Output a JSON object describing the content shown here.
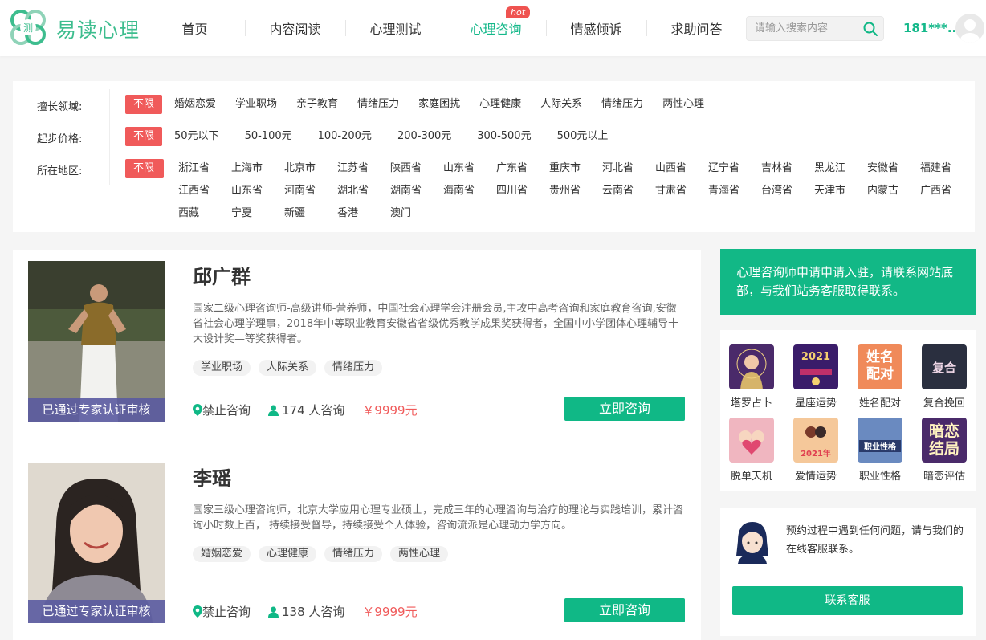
{
  "header": {
    "logo_text": "易读心理",
    "nav": [
      {
        "label": "首页"
      },
      {
        "label": "内容阅读"
      },
      {
        "label": "心理测试"
      },
      {
        "label": "心理咨询",
        "badge": "hot"
      },
      {
        "label": "情感倾诉"
      },
      {
        "label": "求助问答"
      }
    ],
    "search_placeholder": "请输入搜索内容",
    "user_name": "181***..."
  },
  "filters": {
    "field": {
      "label": "擅长领域:",
      "options": [
        "不限",
        "婚姻恋爱",
        "学业职场",
        "亲子教育",
        "情绪压力",
        "家庭困扰",
        "心理健康",
        "人际关系",
        "情绪压力",
        "两性心理"
      ]
    },
    "price": {
      "label": "起步价格:",
      "options": [
        "不限",
        "50元以下",
        "50-100元",
        "100-200元",
        "200-300元",
        "300-500元",
        "500元以上"
      ]
    },
    "region": {
      "label": "所在地区:",
      "options": [
        "不限",
        "浙江省",
        "上海市",
        "北京市",
        "江苏省",
        "陕西省",
        "山东省",
        "广东省",
        "重庆市",
        "河北省",
        "山西省",
        "辽宁省",
        "吉林省",
        "黑龙江",
        "安徽省",
        "福建省",
        "江西省",
        "山东省",
        "河南省",
        "湖北省",
        "湖南省",
        "海南省",
        "四川省",
        "贵州省",
        "云南省",
        "甘肃省",
        "青海省",
        "台湾省",
        "天津市",
        "内蒙古",
        "广西省",
        "西藏",
        "宁夏",
        "新疆",
        "香港",
        "澳门"
      ]
    }
  },
  "counselors": [
    {
      "name": "邱广群",
      "desc": "国家二级心理咨询师-高级讲师-营养师，中国社会心理学会注册会员,主攻中高考咨询和家庭教育咨询,安徽省社会心理学理事，2018年中等职业教育安徽省省级优秀教学成果奖获得者，全国中小学团体心理辅导十大设计奖—等奖获得者。",
      "tags": [
        "学业职场",
        "人际关系",
        "情绪压力"
      ],
      "cert": "已通过专家认证审核",
      "location": "禁止咨询",
      "consult_count": "174 人咨询",
      "price": "￥9999元",
      "button": "立即咨询"
    },
    {
      "name": "李瑶",
      "desc": "国家三级心理咨询师，北京大学应用心理专业硕士，完成三年的心理咨询与治疗的理论与实践培训，累计咨询小时数上百， 持续接受督导，持续接受个人体验，咨询流派是心理动力学方向。",
      "tags": [
        "婚姻恋爱",
        "心理健康",
        "情绪压力",
        "两性心理"
      ],
      "cert": "已通过专家认证审核",
      "location": "禁止咨询",
      "consult_count": "138 人咨询",
      "price": "￥9999元",
      "button": "立即咨询"
    }
  ],
  "sidebar": {
    "notice": "心理咨询师申请申请入驻，请联系网站底部，与我们站务客服取得联系。",
    "tools": [
      {
        "label": "塔罗占卜",
        "img_text": ""
      },
      {
        "label": "星座运势",
        "img_text": "2021"
      },
      {
        "label": "姓名配对",
        "img_text": "姓名配对"
      },
      {
        "label": "复合挽回",
        "img_text": "复合"
      },
      {
        "label": "脱单天机",
        "img_text": ""
      },
      {
        "label": "爱情运势",
        "img_text": "2021年"
      },
      {
        "label": "职业性格",
        "img_text": "职业性格"
      },
      {
        "label": "暗恋评估",
        "img_text": "暗恋结局"
      }
    ],
    "service_text": "预约过程中遇到任何问题，请与我们的在线客服联系。",
    "service_button": "联系客服"
  },
  "colors": {
    "brand_green": "#10b886",
    "accent_red": "#f05a5a",
    "cert_bar": "#5a5aa0"
  }
}
